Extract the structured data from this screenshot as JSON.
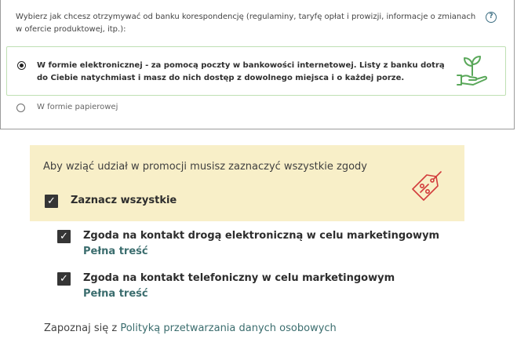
{
  "correspondence": {
    "question": "Wybierz jak chcesz otrzymywać od banku korespondencję (regulaminy, taryfę opłat i prowizji, informacje o zmianach w ofercie produktowej, itp.):",
    "help_symbol": "?",
    "options": [
      {
        "label": "W formie elektronicznej - za pomocą poczty w bankowości internetowej. Listy z banku dotrą do Ciebie natychmiast i masz do nich dostęp z dowolnego miejsca i o każdej porze.",
        "selected": true,
        "icon": "hand-plant-icon"
      },
      {
        "label": "W formie papierowej",
        "selected": false
      }
    ]
  },
  "promo": {
    "text": "Aby wziąć udział w promocji musisz zaznaczyć wszystkie zgody",
    "select_all_label": "Zaznacz wszystkie",
    "select_all_checked": true,
    "icon": "discount-tag-icon",
    "accent_color": "#d23c3c",
    "background_color": "#f8efc8"
  },
  "consents": [
    {
      "label": "Zgoda na kontakt drogą elektroniczną w celu marketingowym",
      "link": "Pełna treść",
      "checked": true
    },
    {
      "label": "Zgoda na kontakt telefoniczny w celu marketingowym",
      "link": "Pełna treść",
      "checked": true
    }
  ],
  "privacy": {
    "prefix": "Zapoznaj się z",
    "link": "Polityką przetwarzania danych osobowych"
  },
  "checkmark": "✓"
}
